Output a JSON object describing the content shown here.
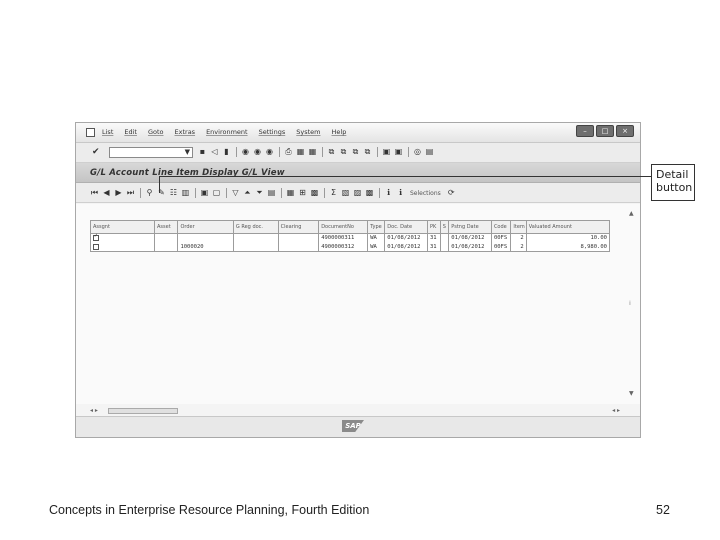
{
  "menubar": {
    "items": [
      "List",
      "Edit",
      "Goto",
      "Extras",
      "Environment",
      "Settings",
      "System",
      "Help"
    ]
  },
  "window_title": "G/L Account Line Item Display G/L View",
  "appbar": {
    "selections_label": "Selections"
  },
  "table": {
    "columns": [
      "Assgnt",
      "Asset",
      "Order",
      "G Reg doc.",
      "Clearing",
      "DocumentNo",
      "Type",
      "Doc. Date",
      "PK",
      "S",
      "Pstng Date",
      "Code",
      "Item",
      "Valuated Amount"
    ],
    "rows": [
      {
        "checked": true,
        "order": "",
        "doc_no": "4900000311",
        "type": "WA",
        "doc_date": "01/08/2012",
        "pk": "31",
        "pstng_date": "01/08/2012",
        "code": "00FS",
        "item": "2",
        "amount": "10.00"
      },
      {
        "checked": false,
        "order": "1000020",
        "doc_no": "4900000312",
        "type": "WA",
        "doc_date": "01/08/2012",
        "pk": "31",
        "pstng_date": "01/08/2012",
        "code": "00FS",
        "item": "2",
        "amount": "8,980.00"
      }
    ]
  },
  "callout": {
    "line1": "Detail",
    "line2": "button"
  },
  "footer": {
    "left": "Concepts in Enterprise Resource Planning, Fourth Edition",
    "page": "52"
  },
  "status": {
    "logo": "SAP"
  }
}
